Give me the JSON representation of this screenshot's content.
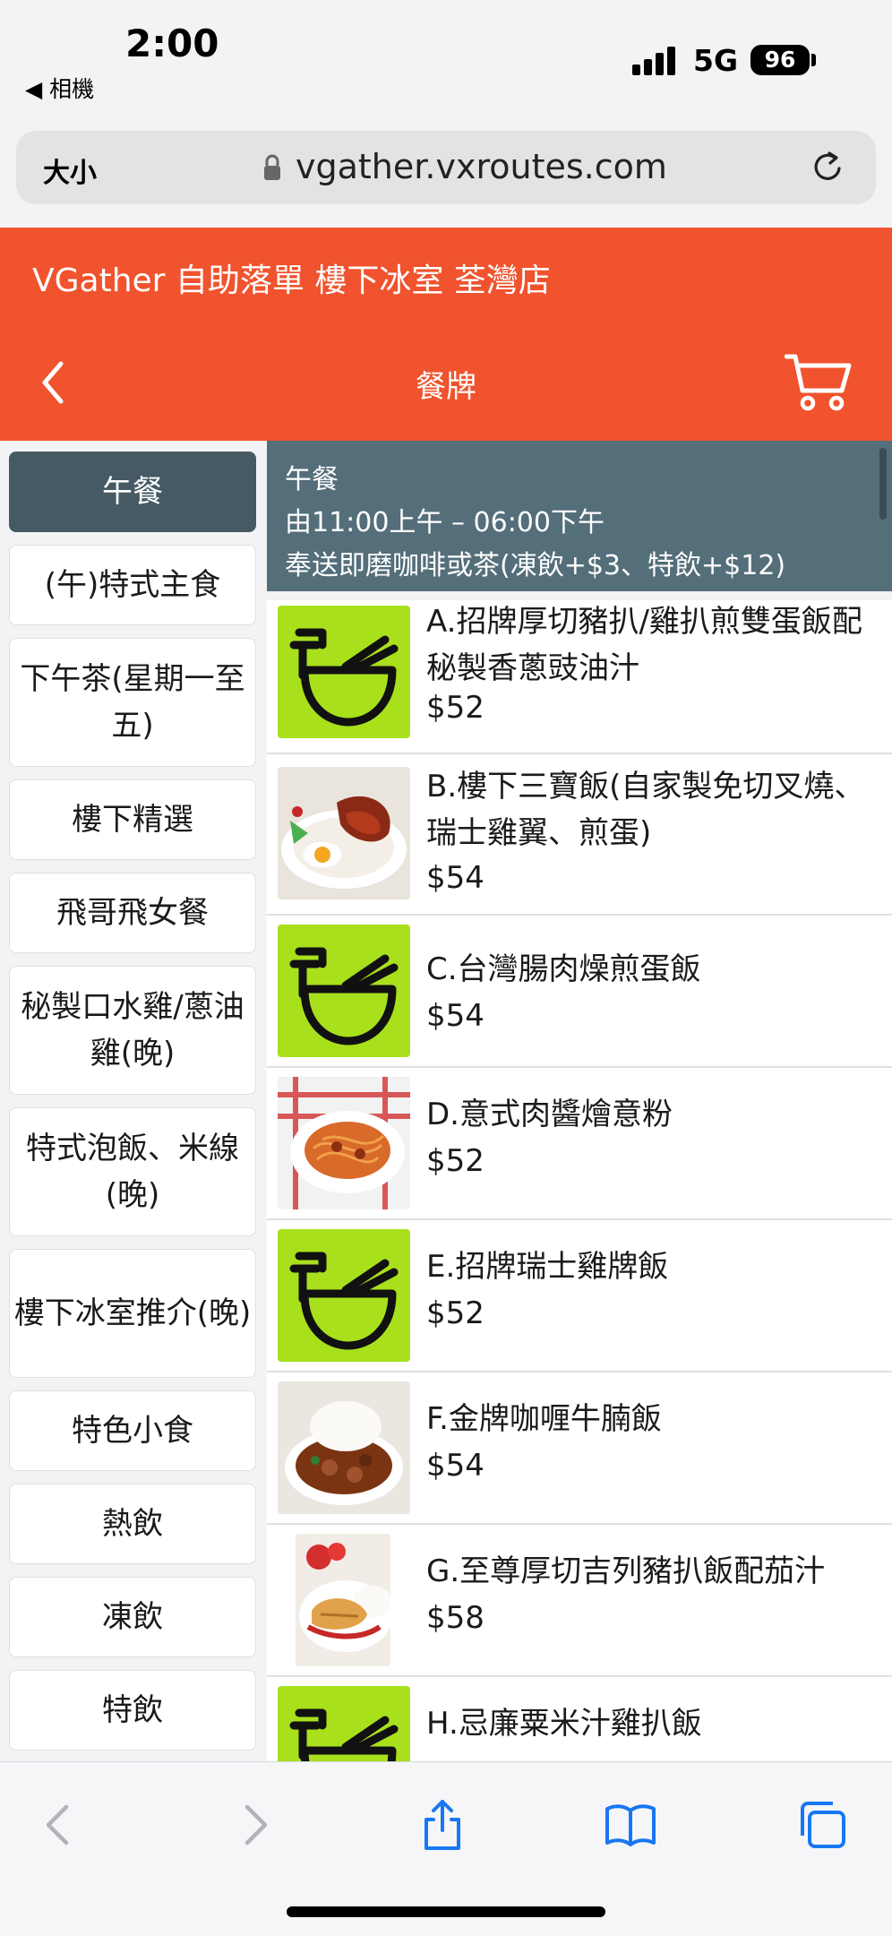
{
  "status_bar": {
    "time": "2:00",
    "back_app": "◀ 相機",
    "network": "5G",
    "battery": "96"
  },
  "url_bar": {
    "text_size_label": "大小",
    "domain": "vgather.vxroutes.com"
  },
  "header": {
    "store_name": "VGather 自助落單 樓下冰室 荃灣店",
    "page_title": "餐牌",
    "color": "#f0532d"
  },
  "sidebar": {
    "active_color": "#455a64",
    "categories": [
      {
        "label": "午餐",
        "active": true
      },
      {
        "label": "(午)特式主食",
        "active": false
      },
      {
        "label": "下午茶(星期一至五)",
        "active": false
      },
      {
        "label": "樓下精選",
        "active": false
      },
      {
        "label": "飛哥飛女餐",
        "active": false
      },
      {
        "label": "秘製口水雞/蔥油雞(晚)",
        "active": false
      },
      {
        "label": "特式泡飯、米線(晚)",
        "active": false
      },
      {
        "label": "樓下冰室推介(晚)",
        "active": false
      },
      {
        "label": "特色小食",
        "active": false
      },
      {
        "label": "熱飲",
        "active": false
      },
      {
        "label": "凍飲",
        "active": false
      },
      {
        "label": "特飲",
        "active": false
      }
    ]
  },
  "section": {
    "title": "午餐",
    "hours": "由11:00上午 – 06:00下午",
    "note": "奉送即磨咖啡或茶(凍飲+$3、特飲+$12)"
  },
  "items": [
    {
      "name": "A.招牌厚切豬扒/雞扒煎雙蛋飯配秘製香蔥豉油汁",
      "price": "$52",
      "image": "placeholder-bowl-icon"
    },
    {
      "name": "B.樓下三寶飯(自家製免切叉燒、瑞士雞翼、煎蛋)",
      "price": "$54",
      "image": "photo-bbq-pork-rice"
    },
    {
      "name": "C.台灣腸肉燥煎蛋飯",
      "price": "$54",
      "image": "placeholder-bowl-icon"
    },
    {
      "name": "D.意式肉醬燴意粉",
      "price": "$52",
      "image": "photo-spaghetti"
    },
    {
      "name": "E.招牌瑞士雞牌飯",
      "price": "$52",
      "image": "placeholder-bowl-icon"
    },
    {
      "name": "F.金牌咖喱牛腩飯",
      "price": "$54",
      "image": "photo-curry-beef"
    },
    {
      "name": "G.至尊厚切吉列豬扒飯配茄汁",
      "price": "$58",
      "image": "photo-pork-chop"
    },
    {
      "name": "H.忌廉粟米汁雞扒飯",
      "price": "",
      "image": "placeholder-bowl-icon"
    }
  ],
  "placeholder_color": "#a8e01c"
}
